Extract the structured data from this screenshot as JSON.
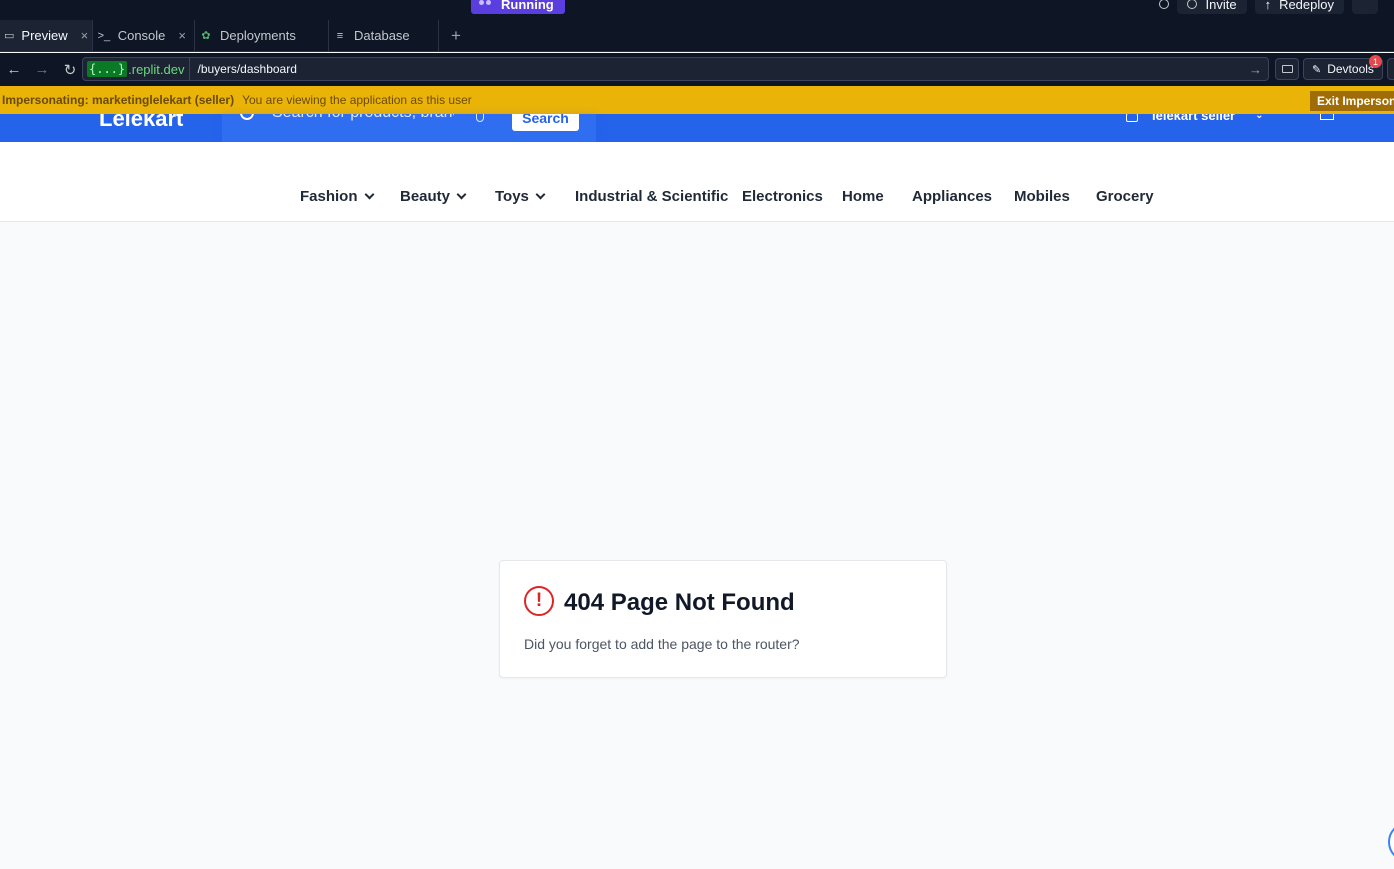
{
  "ide": {
    "run_status": "Running",
    "invite_label": "Invite",
    "redeploy_label": "Redeploy"
  },
  "tabs": [
    {
      "label": "Preview",
      "icon": "monitor-icon",
      "active": true,
      "closable": true
    },
    {
      "label": "Console",
      "icon": "terminal-icon",
      "active": false,
      "closable": true
    },
    {
      "label": "Deployments",
      "icon": "deploy-icon",
      "active": false,
      "closable": false
    },
    {
      "label": "Database",
      "icon": "database-icon",
      "active": false,
      "closable": false
    }
  ],
  "address": {
    "host_code": "{...}",
    "host": ".replit.dev",
    "path": "/buyers/dashboard",
    "devtools_label": "Devtools",
    "devtools_badge": "1"
  },
  "impersonation": {
    "title": "Impersonating: marketinglelekart (seller)",
    "message": "You are viewing the application as this user",
    "exit_label": "Exit Impersona"
  },
  "site": {
    "logo": "Lelekart",
    "search_placeholder": "Search for products, brands",
    "search_button": "Search",
    "user_name": "lelekart seller"
  },
  "categories": [
    {
      "label": "Fashion",
      "dropdown": true
    },
    {
      "label": "Beauty",
      "dropdown": true
    },
    {
      "label": "Toys",
      "dropdown": true
    },
    {
      "label": "Industrial & Scientific",
      "dropdown": false
    },
    {
      "label": "Electronics",
      "dropdown": false
    },
    {
      "label": "Home",
      "dropdown": false
    },
    {
      "label": "Appliances",
      "dropdown": false
    },
    {
      "label": "Mobiles",
      "dropdown": false
    },
    {
      "label": "Grocery",
      "dropdown": false
    }
  ],
  "error_card": {
    "title": "404 Page Not Found",
    "message": "Did you forget to add the page to the router?",
    "icon": "alert-circle-icon"
  },
  "colors": {
    "brand": "#2563eb",
    "banner": "#eab308",
    "error": "#dc2626"
  }
}
